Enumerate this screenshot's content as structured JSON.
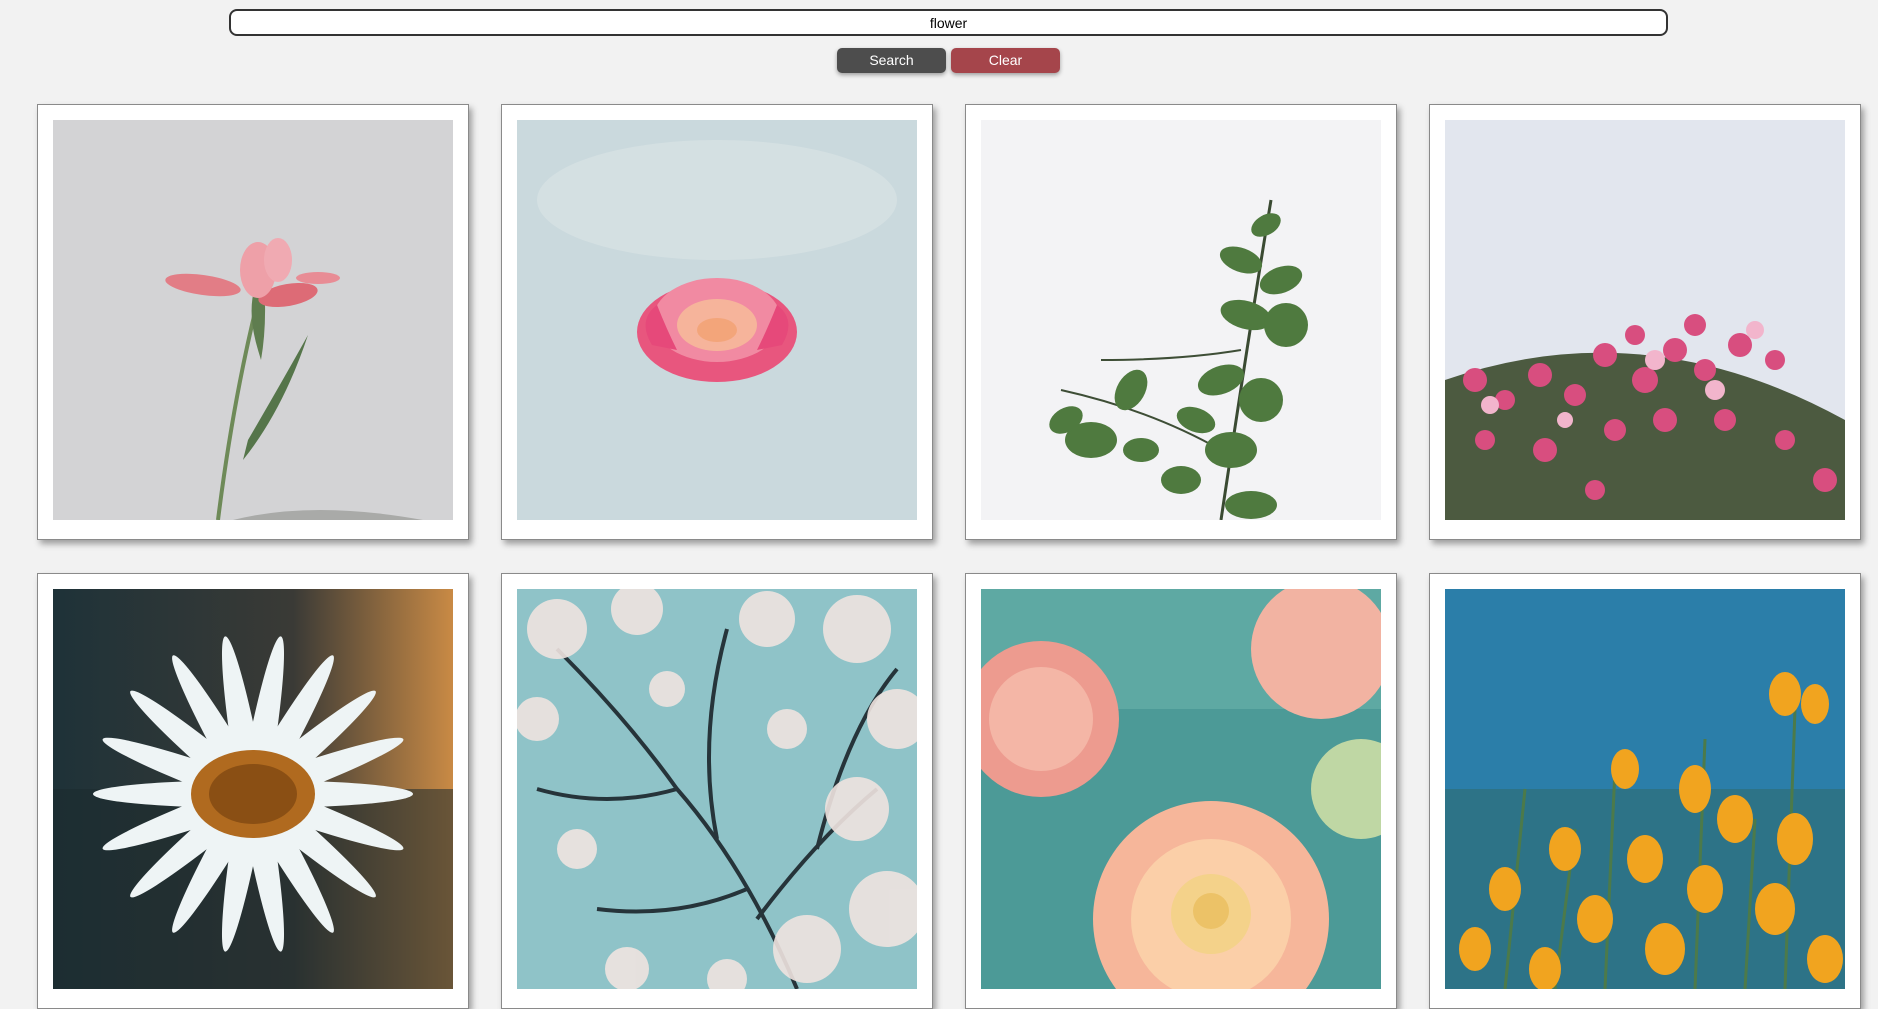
{
  "search": {
    "value": "flower",
    "search_label": "Search",
    "clear_label": "Clear"
  },
  "colors": {
    "search_button": "#4d4d4d",
    "clear_button": "#a5454b"
  },
  "results": [
    {
      "subject": "pink-lily-photo"
    },
    {
      "subject": "pink-rose-photo"
    },
    {
      "subject": "eucalyptus-branch-photo"
    },
    {
      "subject": "pink-blossom-shrub-photo"
    },
    {
      "subject": "white-daisy-photo"
    },
    {
      "subject": "cherry-blossom-tree-photo"
    },
    {
      "subject": "peach-dahlia-photo"
    },
    {
      "subject": "orange-poppies-photo"
    }
  ]
}
